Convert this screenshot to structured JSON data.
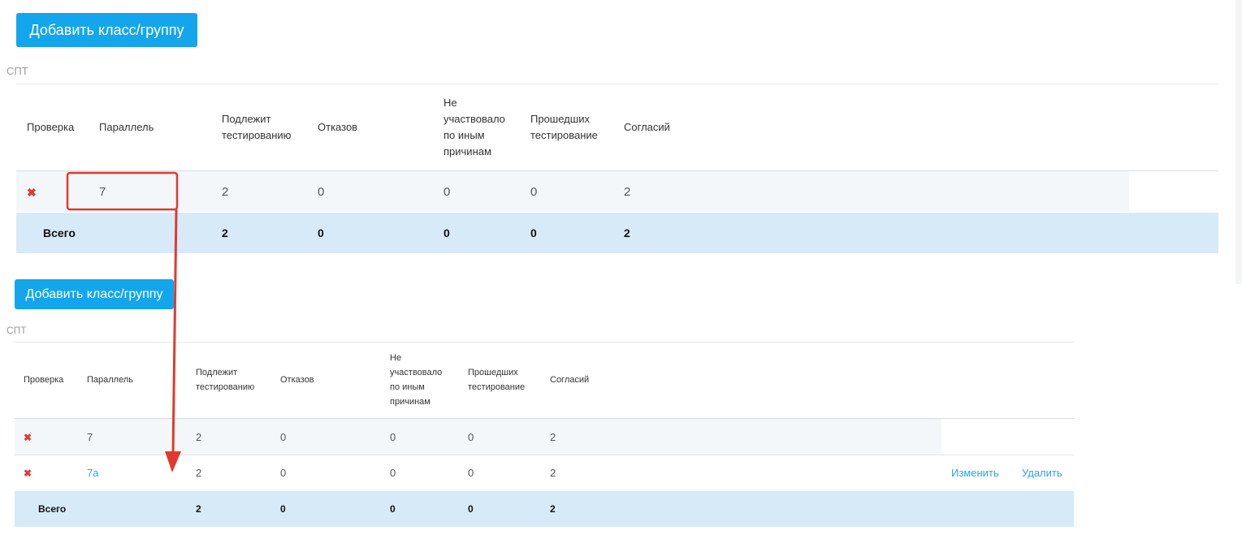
{
  "colors": {
    "button_bg": "#14a6ec",
    "row_bg": "#f4f7f9",
    "total_bg": "#d6eaf8",
    "delete_icon": "#e03a2f",
    "link": "#2aa3e4",
    "highlight_red": "#e03a2f"
  },
  "top": {
    "add_button": "Добавить класс/группу",
    "section_label": "СПТ",
    "headers": {
      "check": "Проверка",
      "parallel": "Параллель",
      "testing": "Подлежит тестированию",
      "refusals": "Отказов",
      "other_reasons": "Не участвовало по иным причинам",
      "passed": "Прошедших тестирование",
      "consents": "Согласий"
    },
    "rows": [
      {
        "icon": "delete-icon",
        "parallel": "7",
        "testing": "2",
        "refusals": "0",
        "other": "0",
        "passed": "0",
        "consents": "2"
      }
    ],
    "total": {
      "label": "Всего",
      "testing": "2",
      "refusals": "0",
      "other": "0",
      "passed": "0",
      "consents": "2"
    }
  },
  "bottom": {
    "add_button": "Добавить класс/группу",
    "section_label": "СПТ",
    "headers": {
      "check": "Проверка",
      "parallel": "Параллель",
      "testing": "Подлежит тестированию",
      "refusals": "Отказов",
      "other_reasons": "Не участвовало по иным причинам",
      "passed": "Прошедших тестирование",
      "consents": "Согласий"
    },
    "rows": [
      {
        "icon": "delete-icon",
        "parallel": "7",
        "testing": "2",
        "refusals": "0",
        "other": "0",
        "passed": "0",
        "consents": "2"
      },
      {
        "icon": "delete-icon",
        "parallel": "7а",
        "testing": "2",
        "refusals": "0",
        "other": "0",
        "passed": "0",
        "consents": "2",
        "edit": "Изменить",
        "delete": "Удалить"
      }
    ],
    "total": {
      "label": "Всего",
      "testing": "2",
      "refusals": "0",
      "other": "0",
      "passed": "0",
      "consents": "2"
    }
  },
  "icons": {
    "delete": "✖"
  }
}
